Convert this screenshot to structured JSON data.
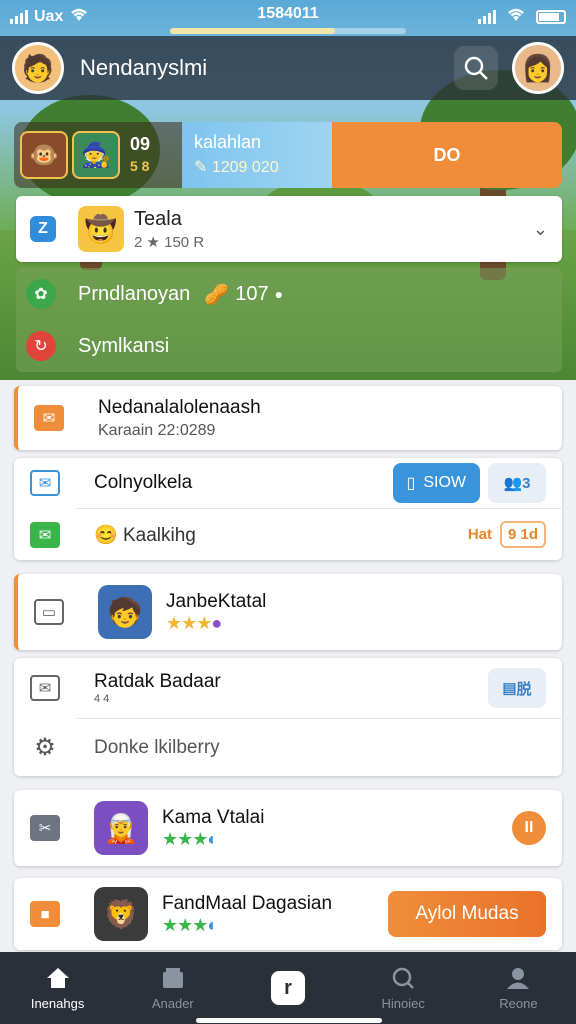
{
  "status": {
    "carrier": "Uax",
    "time": "1584011",
    "progress": 0.7
  },
  "appbar": {
    "title": "Nendanyslmi"
  },
  "promo": {
    "score": "09",
    "score_sub": "5 8",
    "info_title": "kalahlan",
    "info_sub": "1209 020",
    "cta": "DO"
  },
  "selector": {
    "badge": "Z",
    "name": "Teala",
    "rating": "2 ★ 150 R"
  },
  "panel": {
    "row1_label": "Prndlanoyan",
    "row1_value": "107",
    "row2_label": "Symlkansi"
  },
  "card1": {
    "title": "Nedanalalolenaash",
    "subtitle": "Karaain 22:0289"
  },
  "card2": {
    "row1_label": "Colnyolkela",
    "show_button": "SIOW",
    "ghost_button": "3",
    "row2_label": "Kaalkihg",
    "row2_tag": "Hat",
    "row2_pill": "9 1d"
  },
  "card3": {
    "title": "JanbeKtatal"
  },
  "card4": {
    "title": "Ratdak Badaar",
    "subtitle": "4 4",
    "ghost_button": "脱",
    "row2_label": "Donke lkilberry"
  },
  "card5": {
    "title": "Kama Vtalai",
    "action": "II"
  },
  "card6": {
    "title": "FandMaal Dagasian",
    "button": "Aylol Mudas"
  },
  "nav": {
    "items": [
      "Inenahgs",
      "Anader",
      "",
      "Hinoiec",
      "Reone"
    ]
  },
  "colors": {
    "accent": "#f08d3a",
    "blue": "#3a94dc",
    "navbg": "#2a2f38"
  }
}
